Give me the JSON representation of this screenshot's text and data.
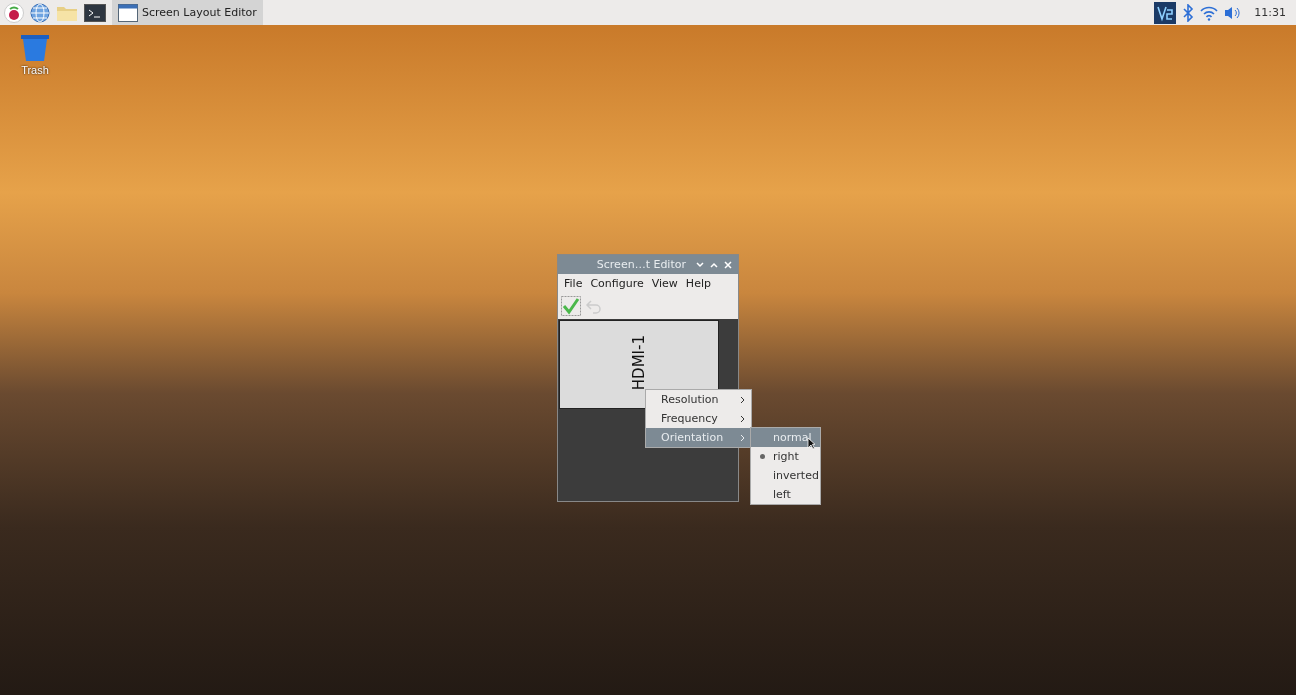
{
  "taskbar": {
    "tasks": [
      {
        "label": "Screen Layout Editor",
        "selected": true
      }
    ],
    "clock": "11:31"
  },
  "desktop": {
    "icons": [
      {
        "label": "Trash"
      }
    ]
  },
  "window": {
    "title": "Screen…t Editor",
    "menus": [
      "File",
      "Configure",
      "View",
      "Help"
    ],
    "displays": [
      {
        "label": "HDMI-1"
      }
    ]
  },
  "context_menu": {
    "items": [
      {
        "label": "Resolution",
        "highlighted": false
      },
      {
        "label": "Frequency",
        "highlighted": false
      },
      {
        "label": "Orientation",
        "highlighted": true
      }
    ]
  },
  "submenu": {
    "items": [
      {
        "label": "normal",
        "selected": false,
        "highlighted": true
      },
      {
        "label": "right",
        "selected": true,
        "highlighted": false
      },
      {
        "label": "inverted",
        "selected": false,
        "highlighted": false
      },
      {
        "label": "left",
        "selected": false,
        "highlighted": false
      }
    ]
  }
}
